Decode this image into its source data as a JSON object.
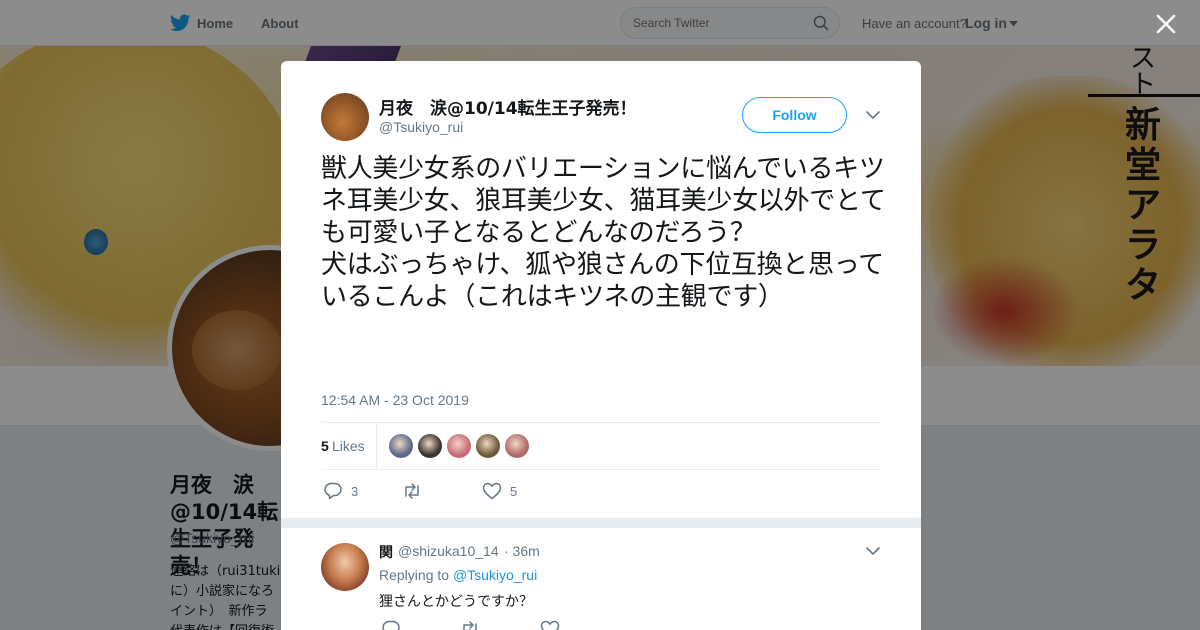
{
  "topbar": {
    "home_label": "Home",
    "about_label": "About",
    "search_placeholder": "Search Twitter",
    "have_account": "Have an account?",
    "login_label": "Log in",
    "icons": [
      "twitter-bird-icon",
      "search-icon",
      "caret-down-icon"
    ]
  },
  "banner": {
    "kanji_top": "スト",
    "kanji_title": "新堂アラタ"
  },
  "profile": {
    "name": "月夜　涙@10/14転生王子発売！",
    "handle": "@Tsukiyo_rui",
    "bio": "連絡は（rui31tuki\nに）小説家になろ\nイント）　新作ラ\n代表作は【回復術"
  },
  "close_icon": "close-icon",
  "tweet": {
    "author_name": "月夜　涙@10/14転生王子発売！",
    "author_handle": "@Tsukiyo_rui",
    "follow_label": "Follow",
    "text": "獣人美少女系のバリエーションに悩んでいるキツネ耳美少女、狼耳美少女、猫耳美少女以外でとても可愛い子となるとどんなのだろう？\n犬はぶっちゃけ、狐や狼さんの下位互換と思っているこんよ（これはキツネの主観です）",
    "timestamp": "12:54 AM - 23 Oct 2019",
    "likes_count": "5",
    "likes_label": "Likes",
    "liker_colors": [
      "#5a6a8a",
      "#3a3230",
      "#c96a7a",
      "#6a5a3a",
      "#b06a6a"
    ],
    "reply_count": "3",
    "retweet_count": "",
    "like_count": "5"
  },
  "reply": {
    "name": "関",
    "handle": "@shizuka10_14",
    "time": "· 36m",
    "replying_prefix": "Replying to",
    "replying_to": "@Tsukiyo_rui",
    "text": "狸さんとかどうですか？"
  },
  "colors": {
    "accent": "#1da1f2",
    "muted": "#657786",
    "text": "#14171a"
  }
}
